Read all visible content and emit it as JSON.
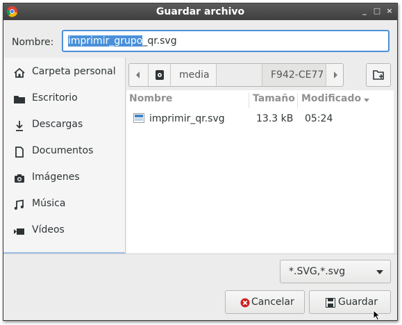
{
  "window": {
    "title": "Guardar archivo",
    "controls": [
      "_",
      "□",
      "×"
    ]
  },
  "name_field": {
    "label": "Nombre:",
    "selected_part": "imprimir_grupo",
    "rest": "_qr.svg"
  },
  "sidebar": {
    "items": [
      {
        "label": "Carpeta personal",
        "icon": "home-icon"
      },
      {
        "label": "Escritorio",
        "icon": "folder-icon"
      },
      {
        "label": "Descargas",
        "icon": "download-icon"
      },
      {
        "label": "Documentos",
        "icon": "document-icon"
      },
      {
        "label": "Imágenes",
        "icon": "camera-icon"
      },
      {
        "label": "Música",
        "icon": "music-icon"
      },
      {
        "label": "Vídeos",
        "icon": "video-icon"
      }
    ]
  },
  "pathbar": {
    "segments": [
      "media",
      "",
      "F942-CE77"
    ]
  },
  "file_list": {
    "columns": {
      "name": "Nombre",
      "size": "Tamaño",
      "modified": "Modificado"
    },
    "rows": [
      {
        "name": "imprimir_qr.svg",
        "size": "13.3 kB",
        "modified": "05:24"
      }
    ]
  },
  "filter": {
    "selected": "*.SVG,*.svg"
  },
  "buttons": {
    "cancel": "Cancelar",
    "save": "Guardar"
  },
  "colors": {
    "accent": "#4a90d9",
    "titlebar": "#3e3e3e",
    "cancel_icon": "#cc2222"
  }
}
